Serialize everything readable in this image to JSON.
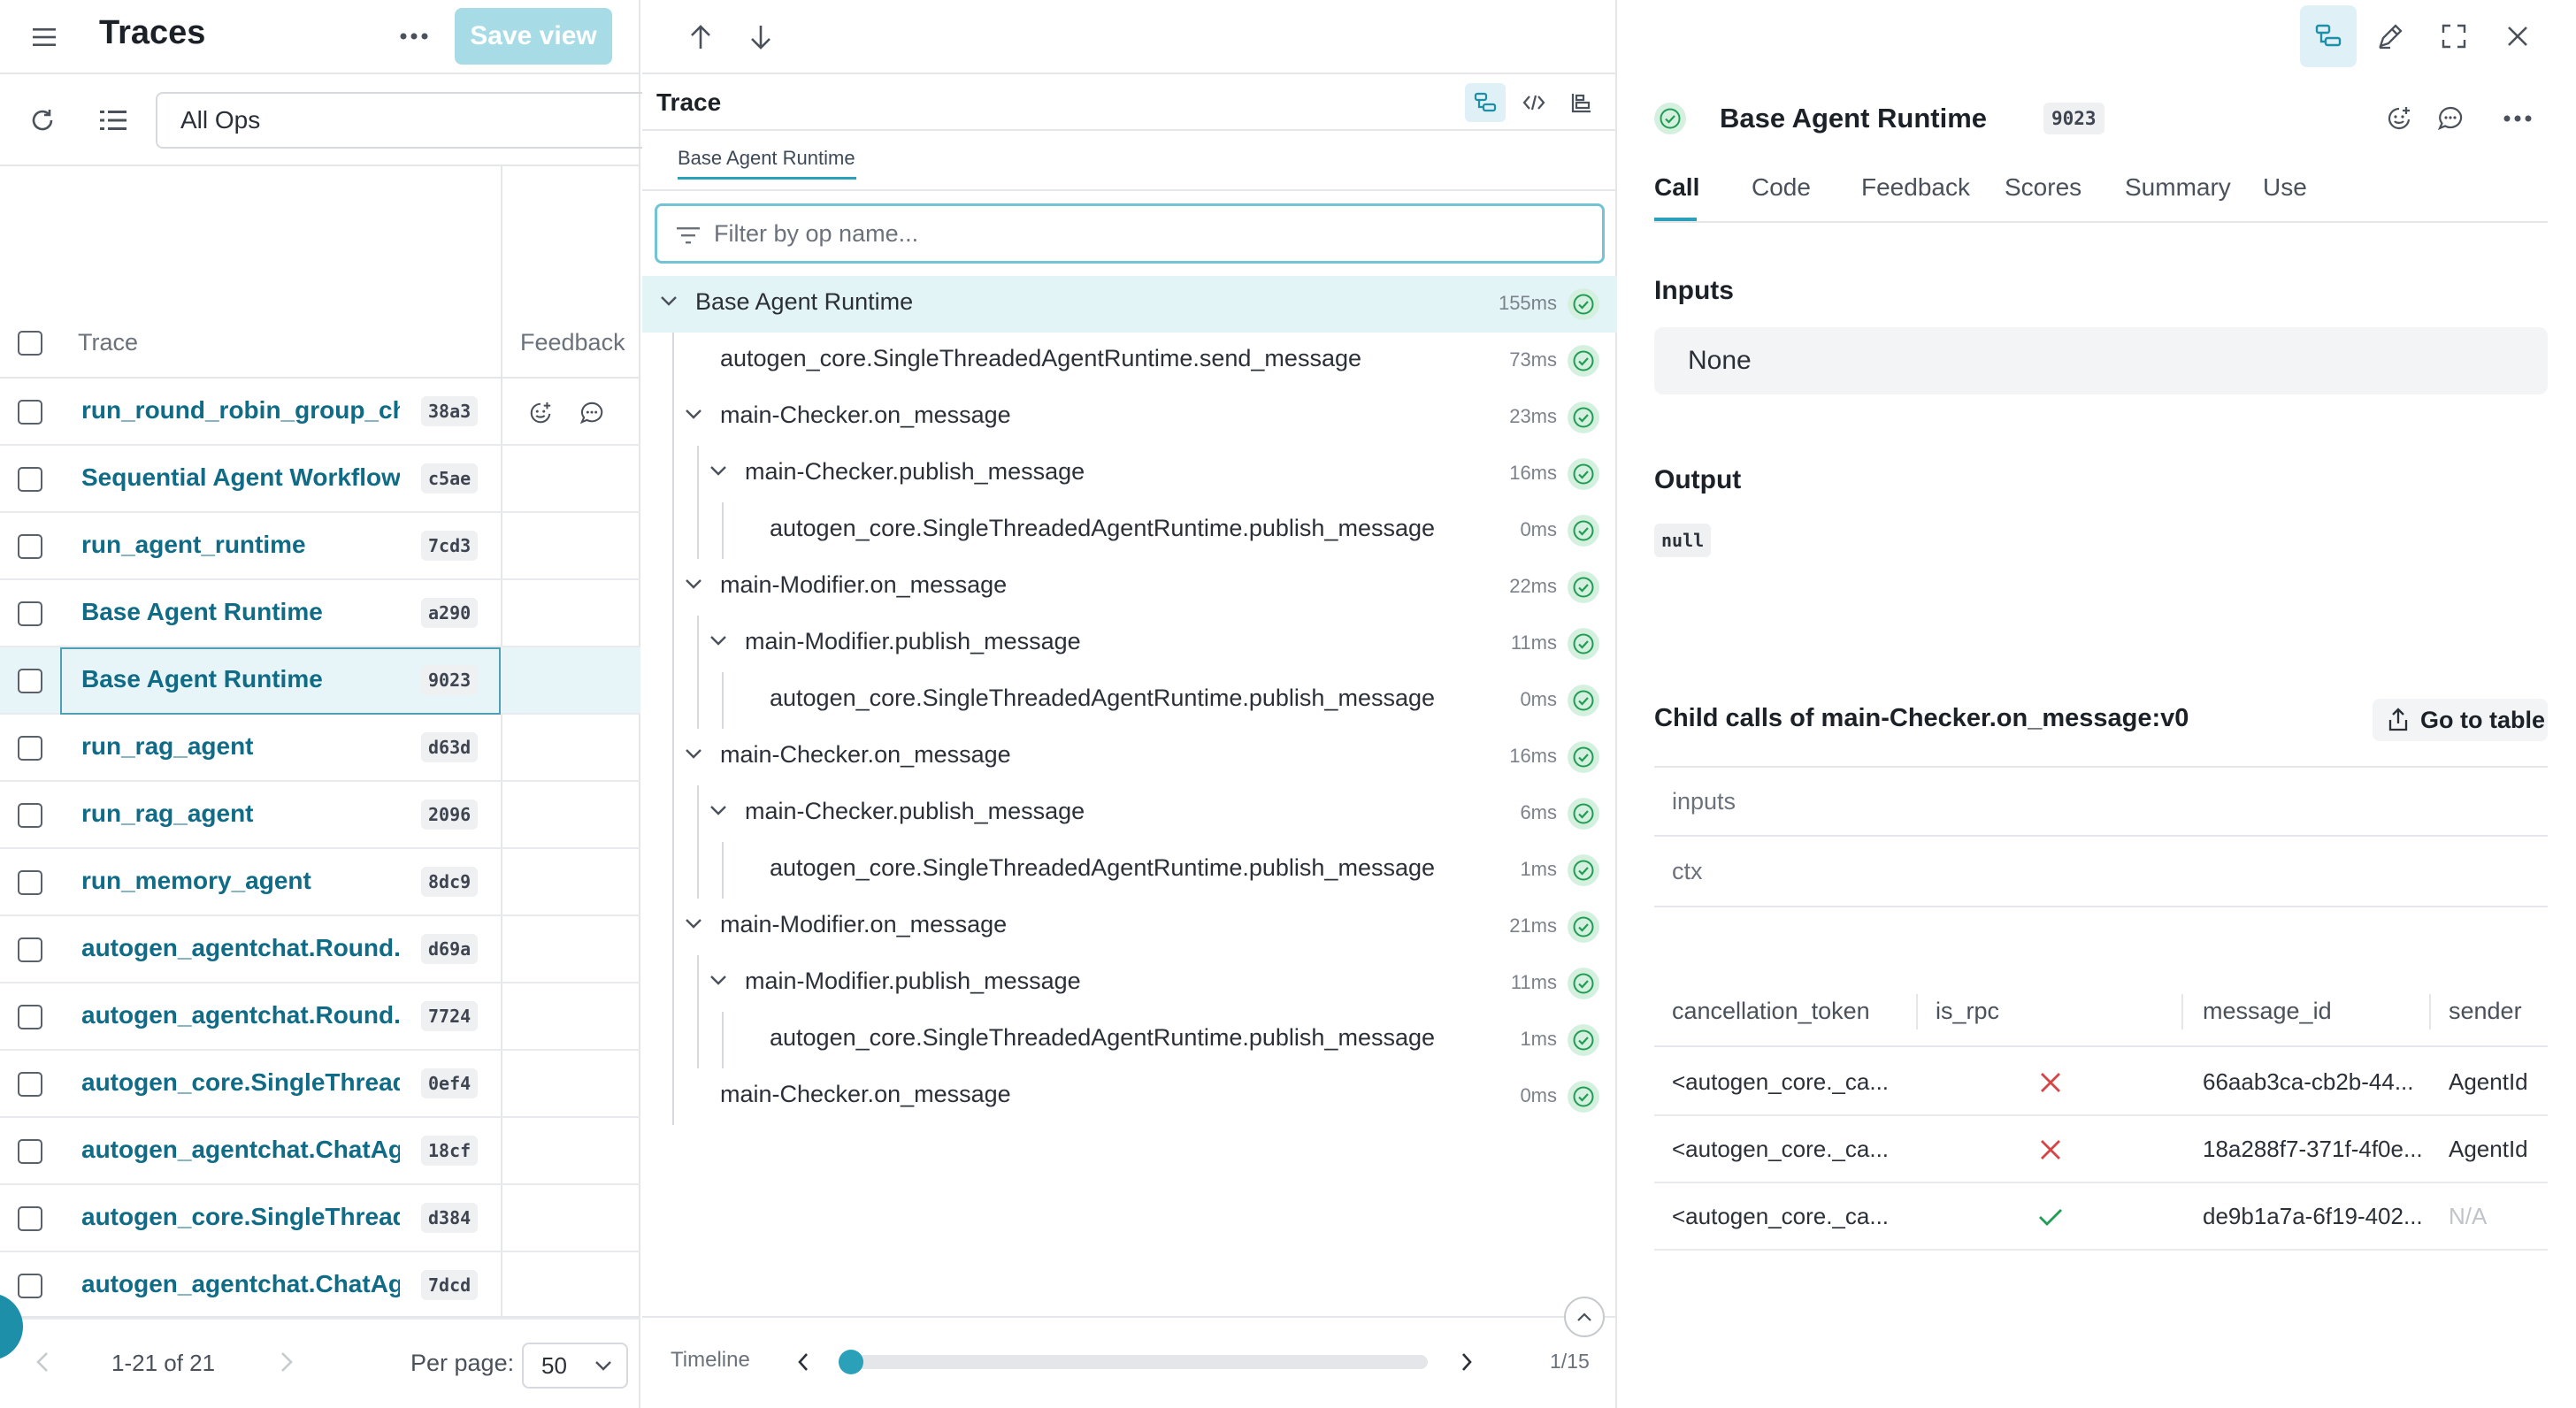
{
  "left": {
    "title": "Traces",
    "save_view": "Save view",
    "filter_value": "All Ops",
    "col_trace": "Trace",
    "col_feedback": "Feedback",
    "rows": [
      {
        "name": "run_round_robin_group_chat",
        "id": "38a3"
      },
      {
        "name": "Sequential Agent Workflow",
        "id": "c5ae"
      },
      {
        "name": "run_agent_runtime",
        "id": "7cd3"
      },
      {
        "name": "Base Agent Runtime",
        "id": "a290"
      },
      {
        "name": "Base Agent Runtime",
        "id": "9023"
      },
      {
        "name": "run_rag_agent",
        "id": "d63d"
      },
      {
        "name": "run_rag_agent",
        "id": "2096"
      },
      {
        "name": "run_memory_agent",
        "id": "8dc9"
      },
      {
        "name": "autogen_agentchat.Round...",
        "id": "d69a"
      },
      {
        "name": "autogen_agentchat.Round...",
        "id": "7724"
      },
      {
        "name": "autogen_core.SingleThread...",
        "id": "0ef4"
      },
      {
        "name": "autogen_agentchat.ChatAg...",
        "id": "18cf"
      },
      {
        "name": "autogen_core.SingleThread...",
        "id": "d384"
      },
      {
        "name": "autogen_agentchat.ChatAg...",
        "id": "7dcd"
      }
    ],
    "pagination": "1-21 of 21",
    "per_page_label": "Per page:",
    "per_page_value": "50"
  },
  "trace": {
    "title": "Trace",
    "breadcrumb": "Base Agent Runtime",
    "filter_placeholder": "Filter by op name...",
    "nodes": [
      {
        "label": "Base Agent Runtime",
        "duration": "155ms"
      },
      {
        "label": "autogen_core.SingleThreadedAgentRuntime.send_message",
        "duration": "73ms"
      },
      {
        "label": "main-Checker.on_message",
        "duration": "23ms"
      },
      {
        "label": "main-Checker.publish_message",
        "duration": "16ms"
      },
      {
        "label": "autogen_core.SingleThreadedAgentRuntime.publish_message",
        "duration": "0ms"
      },
      {
        "label": "main-Modifier.on_message",
        "duration": "22ms"
      },
      {
        "label": "main-Modifier.publish_message",
        "duration": "11ms"
      },
      {
        "label": "autogen_core.SingleThreadedAgentRuntime.publish_message",
        "duration": "0ms"
      },
      {
        "label": "main-Checker.on_message",
        "duration": "16ms"
      },
      {
        "label": "main-Checker.publish_message",
        "duration": "6ms"
      },
      {
        "label": "autogen_core.SingleThreadedAgentRuntime.publish_message",
        "duration": "1ms"
      },
      {
        "label": "main-Modifier.on_message",
        "duration": "21ms"
      },
      {
        "label": "main-Modifier.publish_message",
        "duration": "11ms"
      },
      {
        "label": "autogen_core.SingleThreadedAgentRuntime.publish_message",
        "duration": "1ms"
      },
      {
        "label": "main-Checker.on_message",
        "duration": "0ms"
      }
    ],
    "timeline_label": "Timeline",
    "timeline_position": "1/15"
  },
  "detail": {
    "title": "Base Agent Runtime",
    "id": "9023",
    "tabs": [
      "Call",
      "Code",
      "Feedback",
      "Scores",
      "Summary",
      "Use"
    ],
    "active_tab": "Call",
    "inputs_label": "Inputs",
    "inputs_value": "None",
    "output_label": "Output",
    "output_value": "null",
    "child_title": "Child calls of main-Checker.on_message:v0",
    "go_to_table": "Go to table",
    "groups": [
      "inputs",
      "ctx"
    ],
    "columns": [
      "cancellation_token",
      "is_rpc",
      "message_id",
      "sender"
    ],
    "rows": [
      {
        "cancellation_token": "<autogen_core._ca...",
        "is_rpc": false,
        "message_id": "66aab3ca-cb2b-44...",
        "sender": "AgentId"
      },
      {
        "cancellation_token": "<autogen_core._ca...",
        "is_rpc": false,
        "message_id": "18a288f7-371f-4f0e...",
        "sender": "AgentId"
      },
      {
        "cancellation_token": "<autogen_core._ca...",
        "is_rpc": true,
        "message_id": "de9b1a7a-6f19-402...",
        "sender": "N/A"
      }
    ]
  },
  "colors": {
    "accent": "#2ba0b9",
    "link": "#0f6b86",
    "success": "#1f9d55",
    "error": "#d64545"
  }
}
